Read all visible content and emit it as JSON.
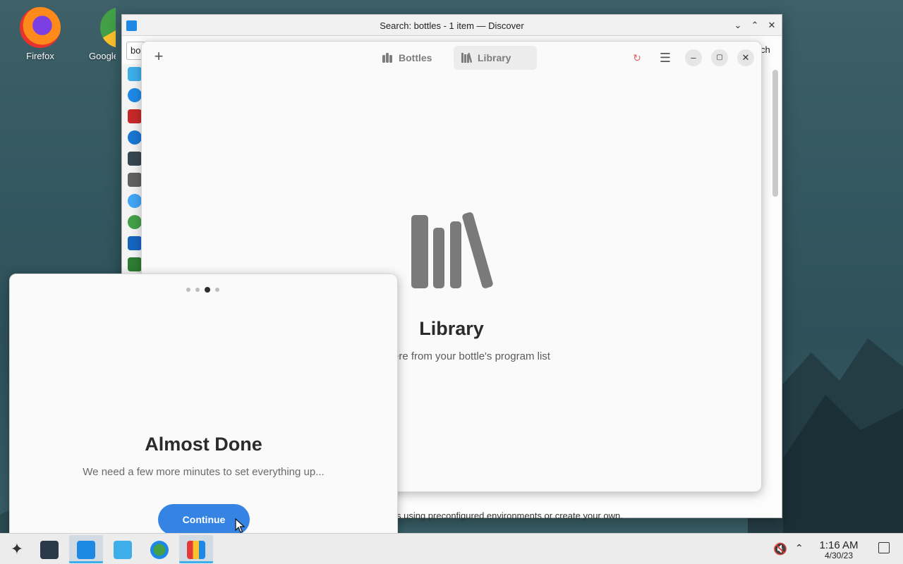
{
  "desktop": {
    "icons": [
      {
        "label": "Firefox"
      },
      {
        "label": "Google"
      }
    ]
  },
  "discover": {
    "title": "Search: bottles - 1 item — Discover",
    "search_fragment": "bo",
    "right_fragment": "ch",
    "bottom_text": "s using preconfigured environments or create your own."
  },
  "bottles": {
    "tabs": [
      {
        "label": "Bottles",
        "active": false
      },
      {
        "label": "Library",
        "active": true
      }
    ],
    "library": {
      "title": "Library",
      "description": "ere from your bottle's program list"
    }
  },
  "welcome": {
    "page_count": 4,
    "current_page": 3,
    "title": "Almost Done",
    "description": "We need a few more minutes to set everything up...",
    "continue_label": "Continue"
  },
  "taskbar": {
    "time": "1:16 AM",
    "date": "4/30/23"
  },
  "colors": {
    "accent": "#3584e4",
    "taskbar_highlight": "#3daee9"
  }
}
